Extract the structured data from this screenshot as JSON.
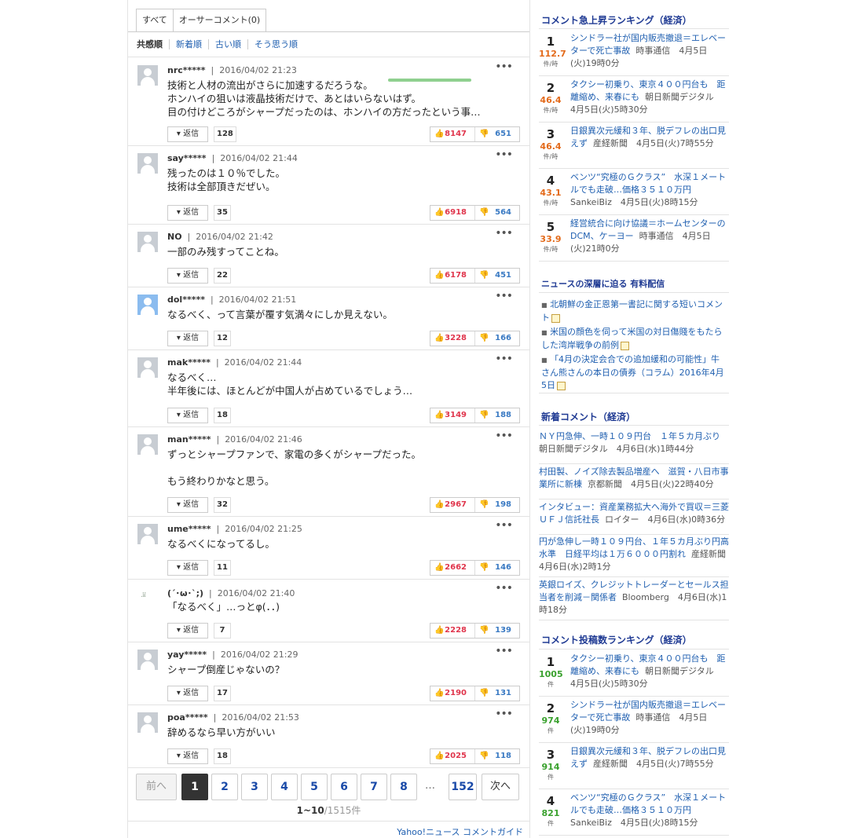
{
  "tabs": [
    {
      "label": "すべて"
    },
    {
      "label": "オーサーコメント(0)"
    }
  ],
  "sorts": [
    {
      "label": "共感順"
    },
    {
      "label": "新着順"
    },
    {
      "label": "古い順"
    },
    {
      "label": "そう思う順"
    }
  ],
  "comments": [
    {
      "user": "nrc*****",
      "date": "2016/04/02 21:23",
      "text": "技術と人材の流出がさらに加速するだろうな。\nホンハイの狙いは液晶技術だけで、あとはいらないはず。\n目の付けどころがシャープだったのは、ホンハイの方だったという事…",
      "replies": "128",
      "up": "8147",
      "down": "651",
      "reply_label": "返信",
      "more": "•••"
    },
    {
      "user": "say*****",
      "date": "2016/04/02 21:44",
      "text": "残ったのは１０％でした。\n技術は全部頂きだぜい。",
      "replies": "35",
      "up": "6918",
      "down": "564",
      "reply_label": "返信",
      "more": "•••"
    },
    {
      "user": "NO",
      "date": "2016/04/02 21:42",
      "text": "一部のみ残すってことね。",
      "replies": "22",
      "up": "6178",
      "down": "451",
      "reply_label": "返信",
      "more": "•••"
    },
    {
      "user": "dol*****",
      "date": "2016/04/02 21:51",
      "text": "なるべく、って言葉が覆す気満々にしか見えない。",
      "replies": "12",
      "up": "3228",
      "down": "166",
      "reply_label": "返信",
      "more": "•••"
    },
    {
      "user": "mak*****",
      "date": "2016/04/02 21:44",
      "text": "なるべく…\n半年後には、ほとんどが中国人が占めているでしょう…",
      "replies": "18",
      "up": "3149",
      "down": "188",
      "reply_label": "返信",
      "more": "•••"
    },
    {
      "user": "man*****",
      "date": "2016/04/02 21:46",
      "text": "ずっとシャープファンで、家電の多くがシャープだった。\n\nもう終わりかなと思う。",
      "replies": "32",
      "up": "2967",
      "down": "198",
      "reply_label": "返信",
      "more": "•••"
    },
    {
      "user": "ume*****",
      "date": "2016/04/02 21:25",
      "text": "なるべくになってるし。",
      "replies": "11",
      "up": "2662",
      "down": "146",
      "reply_label": "返信",
      "more": "•••"
    },
    {
      "user": "(´･ω･`;)",
      "date": "2016/04/02 21:40",
      "text": "「なるべく」…っとφ(．．)",
      "replies": "7",
      "up": "2228",
      "down": "139",
      "reply_label": "返信",
      "more": "•••"
    },
    {
      "user": "yay*****",
      "date": "2016/04/02 21:29",
      "text": "シャープ倒産じゃないの？",
      "replies": "17",
      "up": "2190",
      "down": "131",
      "reply_label": "返信",
      "more": "•••"
    },
    {
      "user": "poa*****",
      "date": "2016/04/02 21:53",
      "text": "辞めるなら早い方がいい",
      "replies": "18",
      "up": "2025",
      "down": "118",
      "reply_label": "返信",
      "more": "•••"
    }
  ],
  "pagination": {
    "prev": "前へ",
    "next": "次へ",
    "pages": [
      "1",
      "2",
      "3",
      "4",
      "5",
      "6",
      "7",
      "8",
      "152"
    ],
    "ellipsis": "…",
    "current": "1",
    "range": "1~10",
    "total": "/1515件"
  },
  "guide_link": "Yahoo!ニュース コメントガイド",
  "surge_ranking": {
    "title": "コメント急上昇ランキング（経済）",
    "unit": "件/時",
    "items": [
      {
        "rank": "1",
        "value": "112.7",
        "link": "シンドラー社が国内販売撤退＝エレベーターで死亡事故",
        "meta": "時事通信　4月5日(火)19時0分"
      },
      {
        "rank": "2",
        "value": "46.4",
        "link": "タクシー初乗り、東京４００円台も　距離縮め、来春にも",
        "meta": "朝日新聞デジタル　4月5日(火)5時30分"
      },
      {
        "rank": "3",
        "value": "46.4",
        "link": "日銀異次元緩和３年、脱デフレの出口見えず",
        "meta": "産経新聞　4月5日(火)7時55分"
      },
      {
        "rank": "4",
        "value": "43.1",
        "link": "ベンツ“究極のＧクラス”　水深１メートルでも走破…価格３５１０万円",
        "meta": "SankeiBiz　4月5日(火)8時15分"
      },
      {
        "rank": "5",
        "value": "33.9",
        "link": "経営統合に向け協議＝ホームセンターのDCM、ケーヨー",
        "meta": "時事通信　4月5日(火)21時0分"
      }
    ]
  },
  "paid": {
    "title": "ニュースの深層に迫る 有料配信",
    "items": [
      {
        "text": "北朝鮮の金正恩第一書記に関する短いコメント"
      },
      {
        "text": "米国の顔色を伺って米国の対日傷賤をもたらした湾岸戦争の前例"
      },
      {
        "text": "「4月の決定会合での追加緩和の可能性」牛さん熊さんの本日の債券（コラム）2016年4月5日"
      }
    ],
    "bullet": "■"
  },
  "new_comments": {
    "title": "新着コメント（経済）",
    "items": [
      {
        "link": "ＮＹ円急伸、一時１０９円台　１年５カ月ぶり",
        "meta": "朝日新聞デジタル　4月6日(水)1時44分"
      },
      {
        "link": "村田製、ノイズ除去製品増産へ　滋賀・八日市事業所に新棟",
        "meta": "京都新聞　4月5日(火)22時40分"
      },
      {
        "link": "インタビュー：資産業務拡大へ海外で買収＝三菱ＵＦＪ信託社長",
        "meta": "ロイター　4月6日(水)0時36分"
      },
      {
        "link": "円が急伸し一時１０９円台、１年５カ月ぶり円高水準　日経平均は１万６０００円割れ",
        "meta": "産経新聞　4月6日(水)2時1分"
      },
      {
        "link": "英銀ロイズ、クレジットトレーダーとセールス担当者を削減－関係者",
        "meta": "Bloomberg　4月6日(水)1時18分"
      }
    ]
  },
  "post_ranking": {
    "title": "コメント投稿数ランキング（経済）",
    "unit": "件",
    "items": [
      {
        "rank": "1",
        "value": "1005",
        "link": "タクシー初乗り、東京４００円台も　距離縮め、来春にも",
        "meta": "朝日新聞デジタル　4月5日(火)5時30分"
      },
      {
        "rank": "2",
        "value": "974",
        "link": "シンドラー社が国内販売撤退＝エレベーターで死亡事故",
        "meta": "時事通信　4月5日(火)19時0分"
      },
      {
        "rank": "3",
        "value": "914",
        "link": "日銀異次元緩和３年、脱デフレの出口見えず",
        "meta": "産経新聞　4月5日(火)7時55分"
      },
      {
        "rank": "4",
        "value": "821",
        "link": "ベンツ“究極のＧクラス”　水深１メートルでも走破…価格３５１０万円",
        "meta": "SankeiBiz　4月5日(火)8時15分"
      }
    ]
  },
  "colors": {
    "surge_value": "#e36a1a",
    "post_value": "#3aa12e",
    "link": "#1f5fb0",
    "section_title": "#1f3a93"
  }
}
